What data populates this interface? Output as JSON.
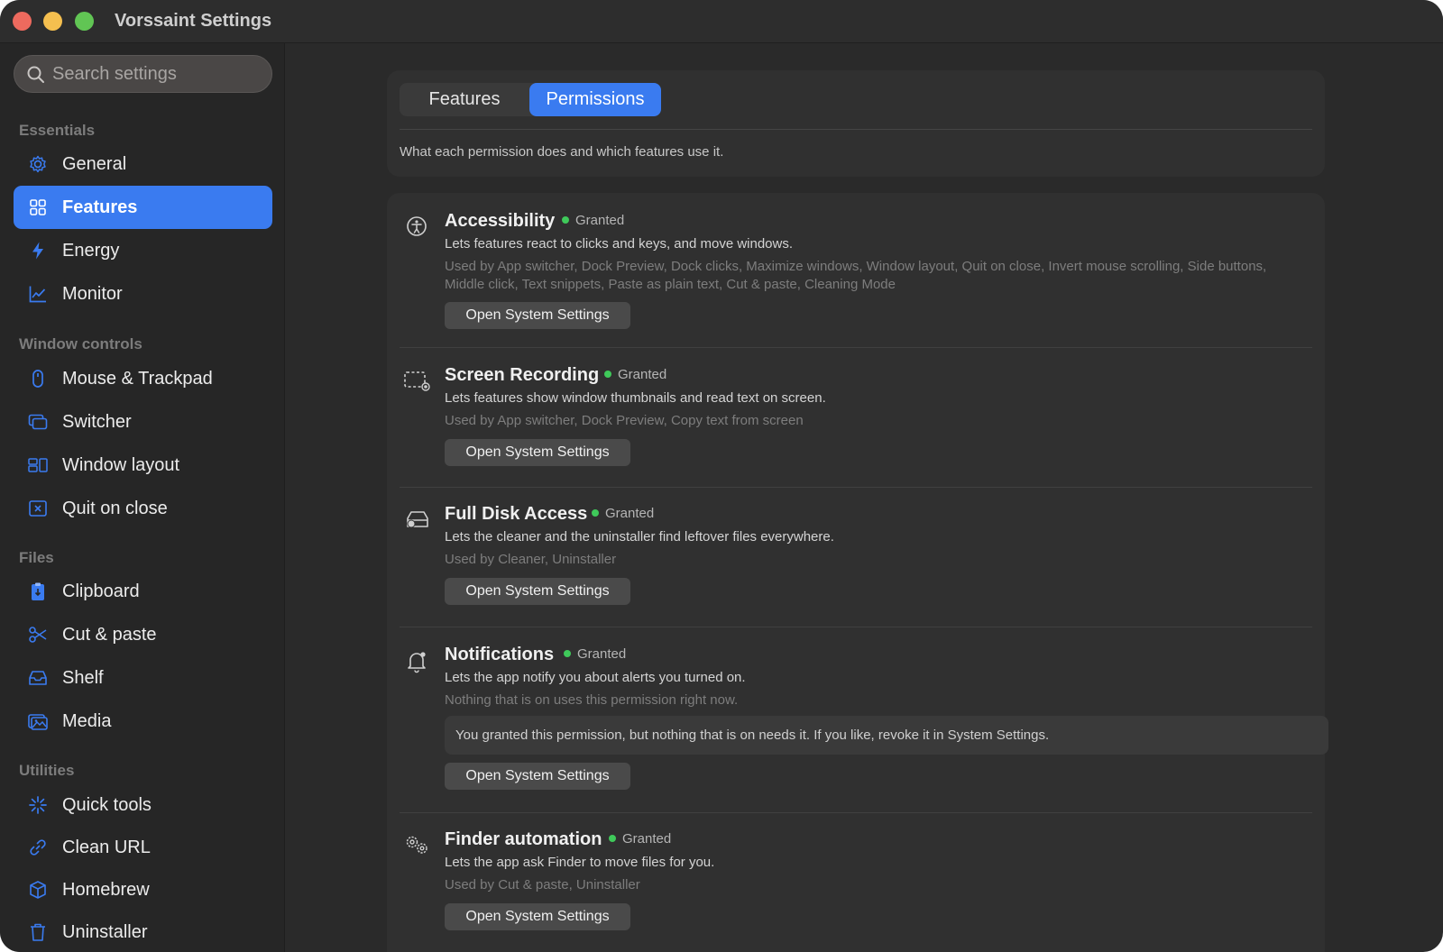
{
  "window": {
    "title": "Vorssaint Settings"
  },
  "search": {
    "placeholder": "Search settings"
  },
  "sidebar": {
    "sections": [
      {
        "label": "Essentials"
      },
      {
        "label": "Window controls"
      },
      {
        "label": "Files"
      },
      {
        "label": "Utilities"
      }
    ],
    "items": [
      {
        "label": "General",
        "icon": "gear-icon"
      },
      {
        "label": "Features",
        "icon": "grid-icon",
        "active": true
      },
      {
        "label": "Energy",
        "icon": "bolt-icon"
      },
      {
        "label": "Monitor",
        "icon": "chart-icon"
      },
      {
        "label": "Mouse & Trackpad",
        "icon": "mouse-icon"
      },
      {
        "label": "Switcher",
        "icon": "windows-icon"
      },
      {
        "label": "Window layout",
        "icon": "layout-icon"
      },
      {
        "label": "Quit on close",
        "icon": "close-box-icon"
      },
      {
        "label": "Clipboard",
        "icon": "clipboard-icon"
      },
      {
        "label": "Cut & paste",
        "icon": "scissors-icon"
      },
      {
        "label": "Shelf",
        "icon": "tray-icon"
      },
      {
        "label": "Media",
        "icon": "photo-icon"
      },
      {
        "label": "Quick tools",
        "icon": "sparkle-icon"
      },
      {
        "label": "Clean URL",
        "icon": "link-icon"
      },
      {
        "label": "Homebrew",
        "icon": "package-icon"
      },
      {
        "label": "Uninstaller",
        "icon": "trash-icon"
      }
    ]
  },
  "tabs": [
    {
      "label": "Features",
      "active": false
    },
    {
      "label": "Permissions",
      "active": true
    }
  ],
  "intro": "What each permission does and which features use it.",
  "permissions": [
    {
      "title": "Accessibility",
      "status": "Granted",
      "icon": "accessibility-icon",
      "desc": "Lets features react to clicks and keys, and move windows.",
      "used": "Used by App switcher, Dock Preview, Dock clicks, Maximize windows, Window layout, Quit on close, Invert mouse scrolling, Side buttons, Middle click, Text snippets, Paste as plain text, Cut & paste, Cleaning Mode",
      "button": "Open System Settings"
    },
    {
      "title": "Screen Recording",
      "status": "Granted",
      "icon": "screen-record-icon",
      "desc": "Lets features show window thumbnails and read text on screen.",
      "used": "Used by App switcher, Dock Preview, Copy text from screen",
      "button": "Open System Settings"
    },
    {
      "title": "Full Disk Access",
      "status": "Granted",
      "icon": "disk-icon",
      "desc": "Lets the cleaner and the uninstaller find leftover files everywhere.",
      "used": "Used by Cleaner, Uninstaller",
      "button": "Open System Settings"
    },
    {
      "title": "Notifications",
      "status": "Granted",
      "icon": "bell-icon",
      "desc": "Lets the app notify you about alerts you turned on.",
      "used": "Nothing that is on uses this permission right now.",
      "note": "You granted this permission, but nothing that is on needs it. If you like, revoke it in System Settings.",
      "button": "Open System Settings"
    },
    {
      "title": "Finder automation",
      "status": "Granted",
      "icon": "gears-icon",
      "desc": "Lets the app ask Finder to move files for you.",
      "used": "Used by Cut & paste, Uninstaller",
      "button": "Open System Settings"
    }
  ],
  "colors": {
    "accent": "#3a7bf0",
    "granted": "#3fc95a"
  }
}
